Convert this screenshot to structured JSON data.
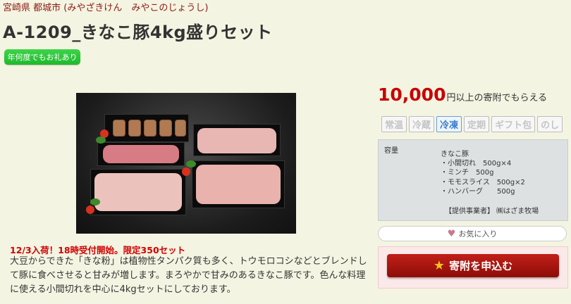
{
  "header": {
    "location": "宮崎県 都城市 (みやざきけん　みやこのじょうし)",
    "title": "A-1209_きなこ豚4kg盛りセット",
    "badge": "年何度でもお礼あり"
  },
  "product": {
    "photo_icon": "product-photo",
    "notice": "12/3入荷！18時受付開始。限定350セット",
    "description": "大豆からできた「きな粉」は植物性タンパク質も多く、トウモロコシなどとブレンドして豚に食べさせると甘みが増します。まろやかで甘みのあるきなこ豚です。色んな料理に使える小間切れを中心に4kgセットにしております。"
  },
  "sidebar": {
    "price": "10,000",
    "price_yen": "円",
    "price_suffix": "以上の寄附でもらえる",
    "temps": [
      {
        "label": "常温",
        "active": false
      },
      {
        "label": "冷蔵",
        "active": false
      },
      {
        "label": "冷凍",
        "active": true
      },
      {
        "label": "定期",
        "active": false
      },
      {
        "label": "ギフト包",
        "active": false
      },
      {
        "label": "のし",
        "active": false
      }
    ],
    "spec": {
      "label": "容量",
      "lines": [
        "きなこ豚",
        "・小間切れ　500g×4",
        "・ミンチ　500g",
        "・モモスライス　500g×2",
        "・ハンバーグ　　500g"
      ],
      "provider": "【提供事業者】 ㈱はざま牧場"
    },
    "fav_label": "お気に入り",
    "apply_label": "寄附を申込む"
  },
  "colors": {
    "accent": "#c80000",
    "badge": "#1fb82c",
    "active_temp": "#3a7bc8"
  }
}
